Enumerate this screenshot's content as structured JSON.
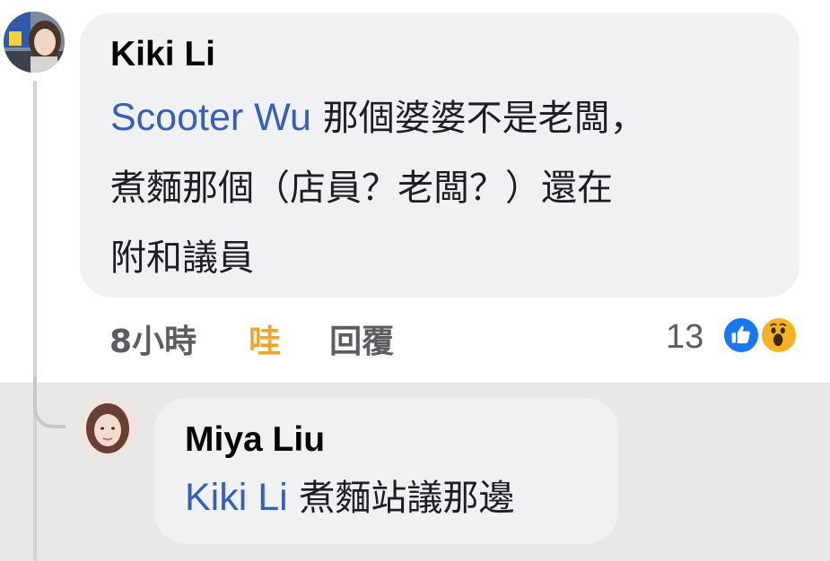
{
  "comment": {
    "author": "Kiki Li",
    "mention": "Scooter Wu",
    "text_line1": "那個婆婆不是老闆，",
    "text_line2": "煮麵那個（店員？老闆？）還在",
    "text_line3": "附和議員",
    "time": "8小時",
    "react_label": "哇",
    "reply_label": "回覆",
    "reaction_count": "13",
    "reactions": [
      "like-icon",
      "wow-icon"
    ]
  },
  "reply": {
    "author": "Miya Liu",
    "mention": "Kiki Li",
    "text": "煮麵站議那邊"
  },
  "colors": {
    "mention": "#385fb8",
    "react_active": "#eea62a",
    "bubble": "#f0f1f3",
    "highlight": "#e8e8e9",
    "like_blue": "#1a77f2",
    "wow_yellow": "#f7b125"
  }
}
